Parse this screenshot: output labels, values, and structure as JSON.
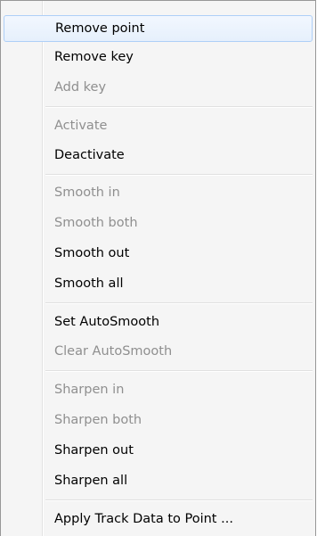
{
  "menu": {
    "items": [
      {
        "label": "Remove point",
        "enabled": true,
        "highlighted": true
      },
      {
        "label": "Remove key",
        "enabled": true
      },
      {
        "label": "Add key",
        "enabled": false
      },
      {
        "label": "Activate",
        "enabled": false
      },
      {
        "label": "Deactivate",
        "enabled": true
      },
      {
        "label": "Smooth in",
        "enabled": false
      },
      {
        "label": "Smooth both",
        "enabled": false
      },
      {
        "label": "Smooth out",
        "enabled": true
      },
      {
        "label": "Smooth all",
        "enabled": true
      },
      {
        "label": "Set AutoSmooth",
        "enabled": true
      },
      {
        "label": "Clear AutoSmooth",
        "enabled": false
      },
      {
        "label": "Sharpen in",
        "enabled": false
      },
      {
        "label": "Sharpen both",
        "enabled": false
      },
      {
        "label": "Sharpen out",
        "enabled": true
      },
      {
        "label": "Sharpen all",
        "enabled": true
      },
      {
        "label": "Apply Track Data to Point ...",
        "enabled": true
      }
    ]
  }
}
